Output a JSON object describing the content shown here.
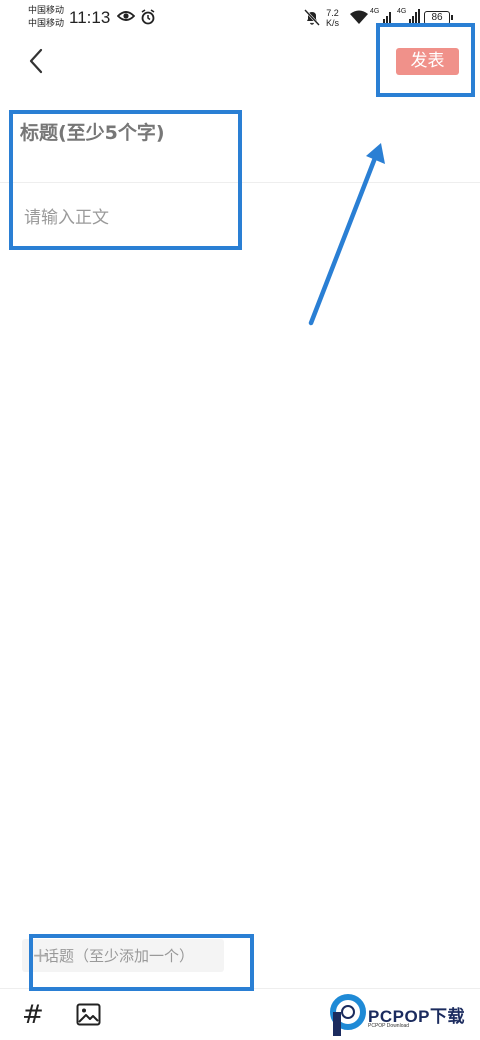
{
  "status_bar": {
    "carrier_1": "中国移动",
    "carrier_2": "中国移动",
    "time": "11:13",
    "net_speed_value": "7.2",
    "net_speed_unit": "K/s",
    "signal_1": "4G",
    "signal_2": "4G",
    "battery": "86"
  },
  "header": {
    "publish_label": "发表",
    "publish_color": "#f0918a"
  },
  "editor": {
    "title_placeholder": "标题(至少5个字)",
    "body_placeholder": "请输入正文"
  },
  "topic": {
    "plus": "+",
    "label": "话题（至少添加一个）"
  },
  "toolbar": {
    "hash_label": "#",
    "image_icon": "image-icon"
  },
  "watermark": {
    "text": "PCPOP下载",
    "sub": "PCPOP Download"
  },
  "annotation_color": "#2a7fd4"
}
